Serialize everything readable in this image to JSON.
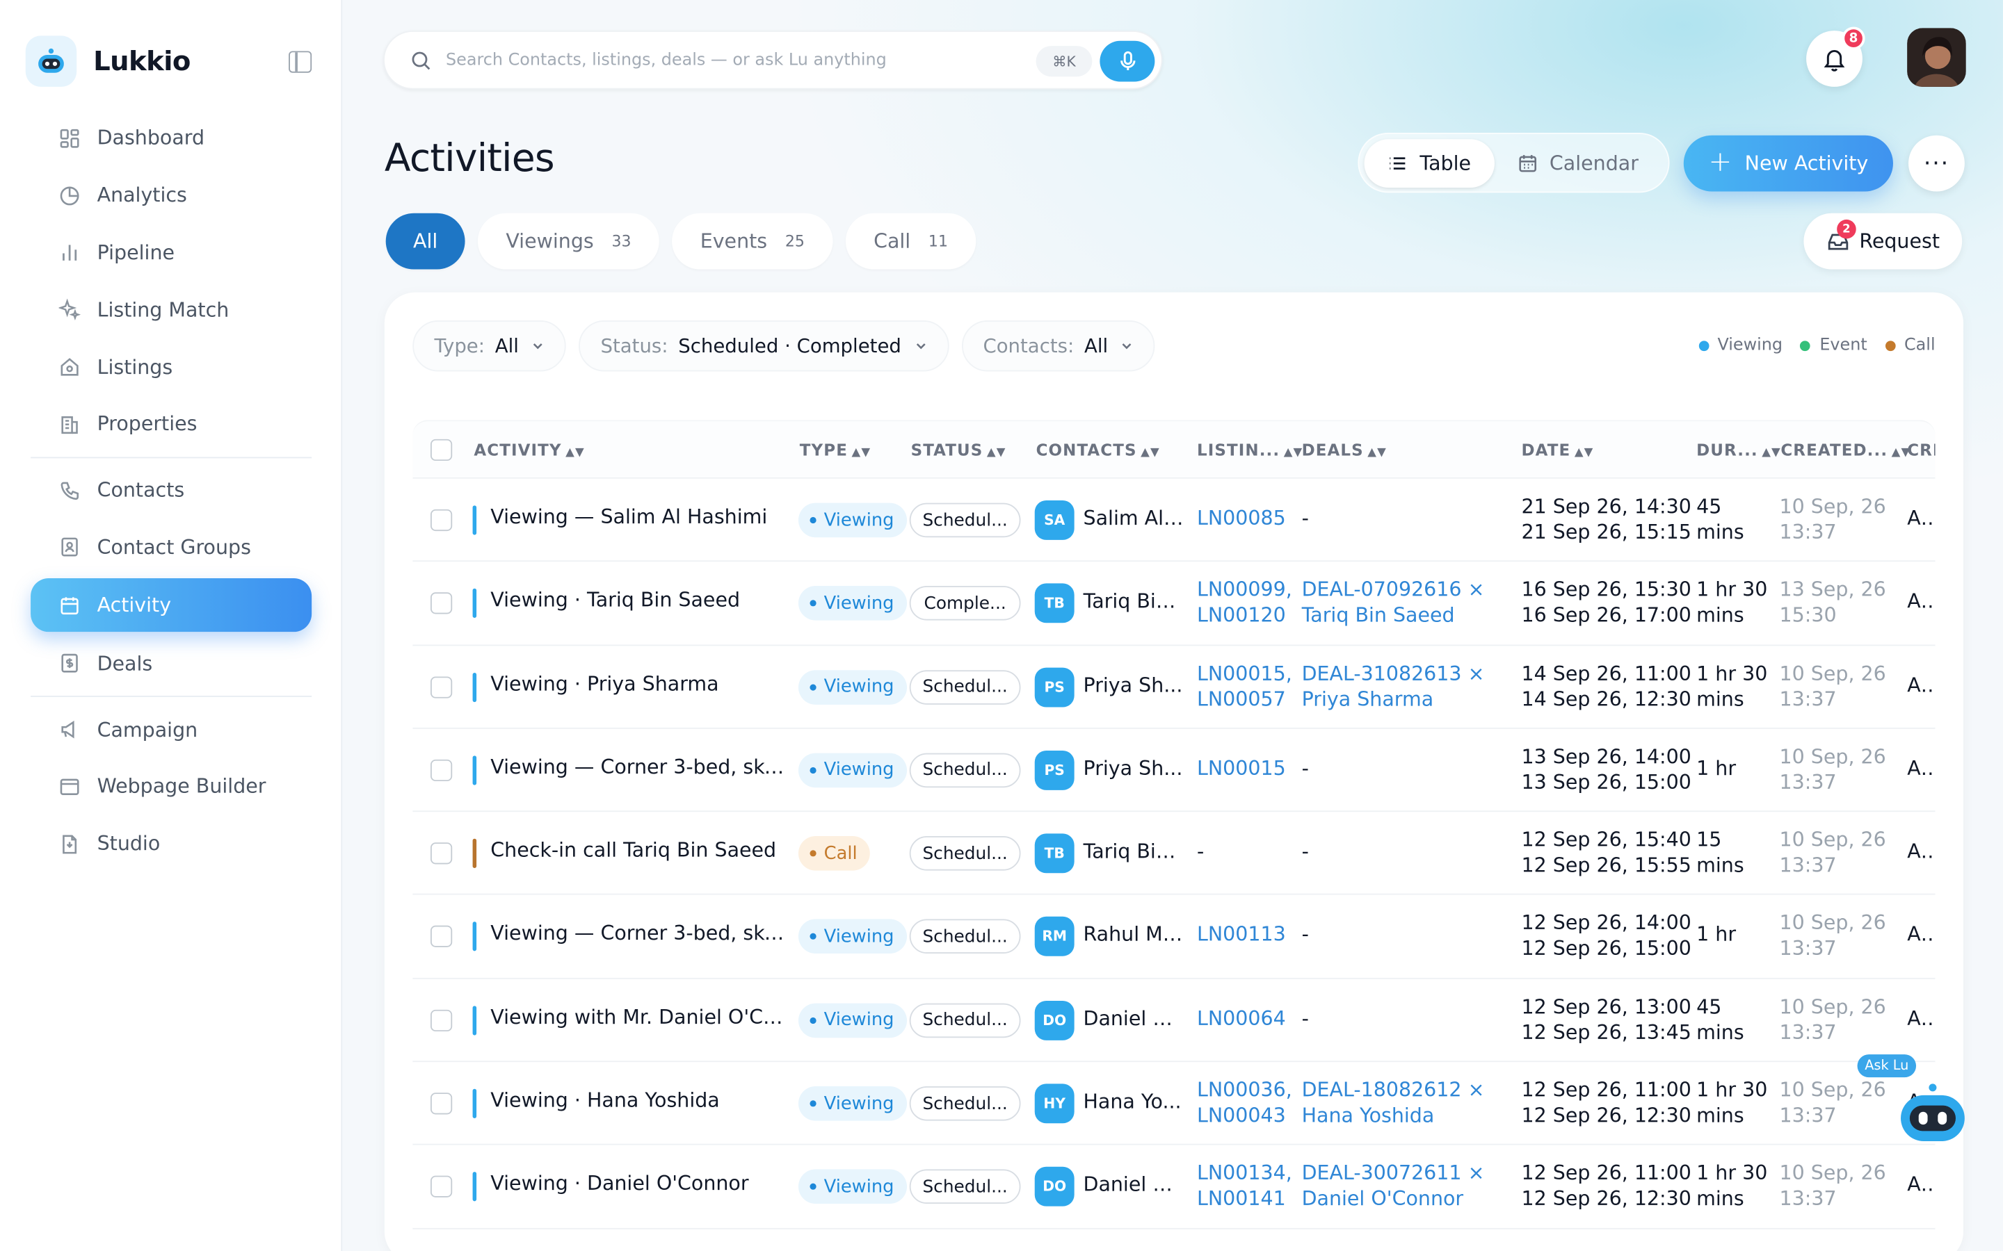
{
  "app": {
    "name": "Lukkio"
  },
  "sidebar": {
    "items": [
      {
        "label": "Dashboard",
        "icon": "dashboard-icon"
      },
      {
        "label": "Analytics",
        "icon": "analytics-icon"
      },
      {
        "label": "Pipeline",
        "icon": "pipeline-icon"
      },
      {
        "label": "Listing Match",
        "icon": "sparkle-icon"
      },
      {
        "label": "Listings",
        "icon": "house-icon"
      },
      {
        "label": "Properties",
        "icon": "building-icon"
      },
      {
        "label": "Contacts",
        "icon": "phone-icon"
      },
      {
        "label": "Contact Groups",
        "icon": "contact-book-icon"
      },
      {
        "label": "Activity",
        "icon": "calendar-icon",
        "active": true
      },
      {
        "label": "Deals",
        "icon": "deal-doc-icon"
      },
      {
        "label": "Campaign",
        "icon": "megaphone-icon"
      },
      {
        "label": "Webpage Builder",
        "icon": "browser-icon"
      },
      {
        "label": "Studio",
        "icon": "studio-icon"
      }
    ]
  },
  "header": {
    "search_placeholder": "Search Contacts, listings, deals — or ask Lu anything",
    "search_shortcut": "⌘K",
    "notifications_count": "8"
  },
  "page": {
    "title": "Activities",
    "view_table": "Table",
    "view_calendar": "Calendar",
    "new_activity": "New Activity",
    "more": "···",
    "request": "Request",
    "request_badge": "2"
  },
  "tabs": [
    {
      "label": "All",
      "count": ""
    },
    {
      "label": "Viewings",
      "count": "33"
    },
    {
      "label": "Events",
      "count": "25"
    },
    {
      "label": "Call",
      "count": "11"
    }
  ],
  "filters": {
    "type_label": "Type:",
    "type_value": "All",
    "status_label": "Status:",
    "status_value": "Scheduled · Completed",
    "contacts_label": "Contacts:",
    "contacts_value": "All"
  },
  "legend": [
    {
      "label": "Viewing",
      "color": "#2ea8ec"
    },
    {
      "label": "Event",
      "color": "#34c07a"
    },
    {
      "label": "Call",
      "color": "#c47a2c"
    }
  ],
  "columns": {
    "activity": "ACTIVITY",
    "type": "TYPE",
    "status": "STATUS",
    "contacts": "CONTACTS",
    "listings": "LISTIN...",
    "deals": "DEALS",
    "date": "DATE",
    "duration": "DUR...",
    "created": "CREATED...",
    "created_by": "CRE"
  },
  "rows": [
    {
      "activity": "Viewing — Salim Al Hashimi",
      "type": "Viewing",
      "status": "Schedul...",
      "initials": "SA",
      "contact": "Salim Al ...",
      "listing1": "LN00085",
      "listing2": "",
      "deal1": "-",
      "deal2": "",
      "date1": "21 Sep 26, 14:30 -",
      "date2": "21 Sep 26, 15:15",
      "dur1": "45",
      "dur2": "mins",
      "created1": "10 Sep, 26",
      "created2": "13:37",
      "by": "Am"
    },
    {
      "activity": "Viewing · Tariq Bin Saeed",
      "type": "Viewing",
      "status": "Comple...",
      "initials": "TB",
      "contact": "Tariq Bin ...",
      "listing1": "LN00099,",
      "listing2": "LN00120",
      "deal1": "DEAL-07092616 ×",
      "deal2": "Tariq Bin Saeed",
      "date1": "16 Sep 26, 15:30 -",
      "date2": "16 Sep 26, 17:00",
      "dur1": "1 hr 30",
      "dur2": "mins",
      "created1": "13 Sep, 26",
      "created2": "15:30",
      "by": "Am"
    },
    {
      "activity": "Viewing · Priya Sharma",
      "type": "Viewing",
      "status": "Schedul...",
      "initials": "PS",
      "contact": "Priya Sh...",
      "listing1": "LN00015,",
      "listing2": "LN00057",
      "deal1": "DEAL-31082613 ×",
      "deal2": "Priya Sharma",
      "date1": "14 Sep 26, 11:00 -",
      "date2": "14 Sep 26, 12:30",
      "dur1": "1 hr 30",
      "dur2": "mins",
      "created1": "10 Sep, 26",
      "created2": "13:37",
      "by": "Am"
    },
    {
      "activity": "Viewing — Corner 3-bed, sky...",
      "type": "Viewing",
      "status": "Schedul...",
      "initials": "PS",
      "contact": "Priya Sh...",
      "listing1": "LN00015",
      "listing2": "",
      "deal1": "-",
      "deal2": "",
      "date1": "13 Sep 26, 14:00 -",
      "date2": "13 Sep 26, 15:00",
      "dur1": "1 hr",
      "dur2": "",
      "created1": "10 Sep, 26",
      "created2": "13:37",
      "by": "Am"
    },
    {
      "activity": "Check-in call Tariq Bin Saeed",
      "type": "Call",
      "status": "Schedul...",
      "initials": "TB",
      "contact": "Tariq Bin ...",
      "listing1": "-",
      "listing2": "",
      "deal1": "-",
      "deal2": "",
      "date1": "12 Sep 26, 15:40 -",
      "date2": "12 Sep 26, 15:55",
      "dur1": "15",
      "dur2": "mins",
      "created1": "10 Sep, 26",
      "created2": "13:37",
      "by": "Am"
    },
    {
      "activity": "Viewing — Corner 3-bed, sky...",
      "type": "Viewing",
      "status": "Schedul...",
      "initials": "RM",
      "contact": "Rahul Me...",
      "listing1": "LN00113",
      "listing2": "",
      "deal1": "-",
      "deal2": "",
      "date1": "12 Sep 26, 14:00 -",
      "date2": "12 Sep 26, 15:00",
      "dur1": "1 hr",
      "dur2": "",
      "created1": "10 Sep, 26",
      "created2": "13:37",
      "by": "Am"
    },
    {
      "activity": "Viewing with Mr. Daniel O'Co...",
      "type": "Viewing",
      "status": "Schedul...",
      "initials": "DO",
      "contact": "Daniel O'...",
      "listing1": "LN00064",
      "listing2": "",
      "deal1": "-",
      "deal2": "",
      "date1": "12 Sep 26, 13:00 -",
      "date2": "12 Sep 26, 13:45",
      "dur1": "45",
      "dur2": "mins",
      "created1": "10 Sep, 26",
      "created2": "13:37",
      "by": "Am"
    },
    {
      "activity": "Viewing · Hana Yoshida",
      "type": "Viewing",
      "status": "Schedul...",
      "initials": "HY",
      "contact": "Hana Yo...",
      "listing1": "LN00036,",
      "listing2": "LN00043",
      "deal1": "DEAL-18082612 ×",
      "deal2": "Hana Yoshida",
      "date1": "12 Sep 26, 11:00 -",
      "date2": "12 Sep 26, 12:30",
      "dur1": "1 hr 30",
      "dur2": "mins",
      "created1": "10 Sep, 26",
      "created2": "13:37",
      "by": "Am"
    },
    {
      "activity": "Viewing · Daniel O'Connor",
      "type": "Viewing",
      "status": "Schedul...",
      "initials": "DO",
      "contact": "Daniel O'...",
      "listing1": "LN00134,",
      "listing2": "LN00141",
      "deal1": "DEAL-30072611 ×",
      "deal2": "Daniel O'Connor",
      "date1": "12 Sep 26, 11:00 -",
      "date2": "12 Sep 26, 12:30",
      "dur1": "1 hr 30",
      "dur2": "mins",
      "created1": "10 Sep, 26",
      "created2": "13:37",
      "by": "Am"
    }
  ],
  "assistant": {
    "label": "Ask Lu"
  }
}
